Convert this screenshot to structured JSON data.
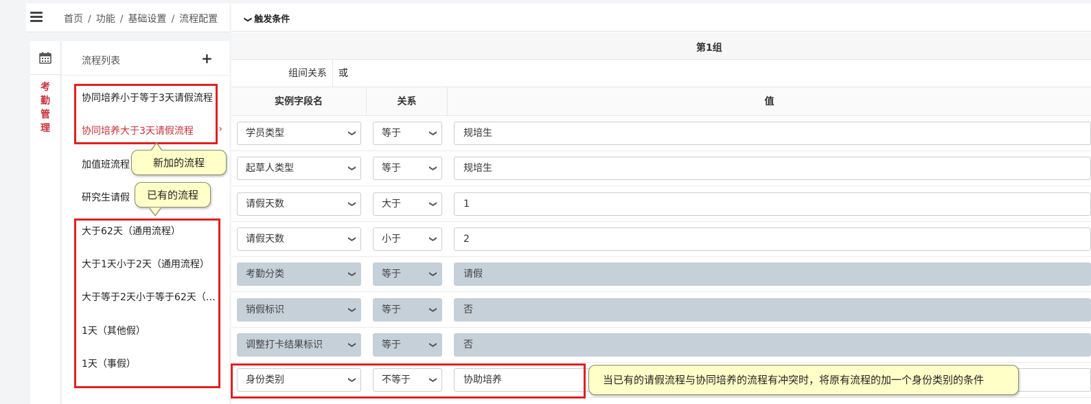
{
  "breadcrumb": [
    "首页",
    "功能",
    "基础设置",
    "流程配置"
  ],
  "rail": {
    "icon": "calendar-icon",
    "label": [
      "考",
      "勤",
      "管",
      "理"
    ]
  },
  "process_list": {
    "title": "流程列表",
    "add_icon": "plus-icon",
    "items": [
      "协同培养小于等于3天请假流程",
      "协同培养大于3天请假流程",
      "加值班流程",
      "研究生请假",
      "大于62天（通用流程）",
      "大于1天小于2天（通用流程）",
      "大于等于2天小于等于62天（通...",
      "1天（其他假）",
      "1天（事假）"
    ],
    "active_index": 1
  },
  "callouts": {
    "new_process": "新加的流程",
    "existing_process": "已有的流程",
    "conflict_note": "当已有的请假流程与协同培养的流程有冲突时，将原有流程的加一个身份类别的条件"
  },
  "trigger": {
    "label": "触发条件"
  },
  "group": {
    "title": "第1组",
    "relation_label": "组间关系",
    "relation_value": "或",
    "columns": [
      "实例字段名",
      "关系",
      "值"
    ],
    "rows": [
      {
        "field": "学员类型",
        "op": "等于",
        "value": "规培生",
        "disabled": false
      },
      {
        "field": "起草人类型",
        "op": "等于",
        "value": "规培生",
        "disabled": false
      },
      {
        "field": "请假天数",
        "op": "大于",
        "value": "1",
        "disabled": false
      },
      {
        "field": "请假天数",
        "op": "小于",
        "value": "2",
        "disabled": false
      },
      {
        "field": "考勤分类",
        "op": "等于",
        "value": "请假",
        "disabled": true
      },
      {
        "field": "销假标识",
        "op": "等于",
        "value": "否",
        "disabled": true
      },
      {
        "field": "调整打卡结果标识",
        "op": "等于",
        "value": "否",
        "disabled": true
      },
      {
        "field": "身份类别",
        "op": "不等于",
        "value": "协助培养",
        "disabled": false
      }
    ]
  },
  "colors": {
    "accent_red": "#c8303c",
    "highlight_red": "#e02020",
    "callout_bg": "#ffffc8",
    "disabled_bg": "#c5d0d9"
  }
}
